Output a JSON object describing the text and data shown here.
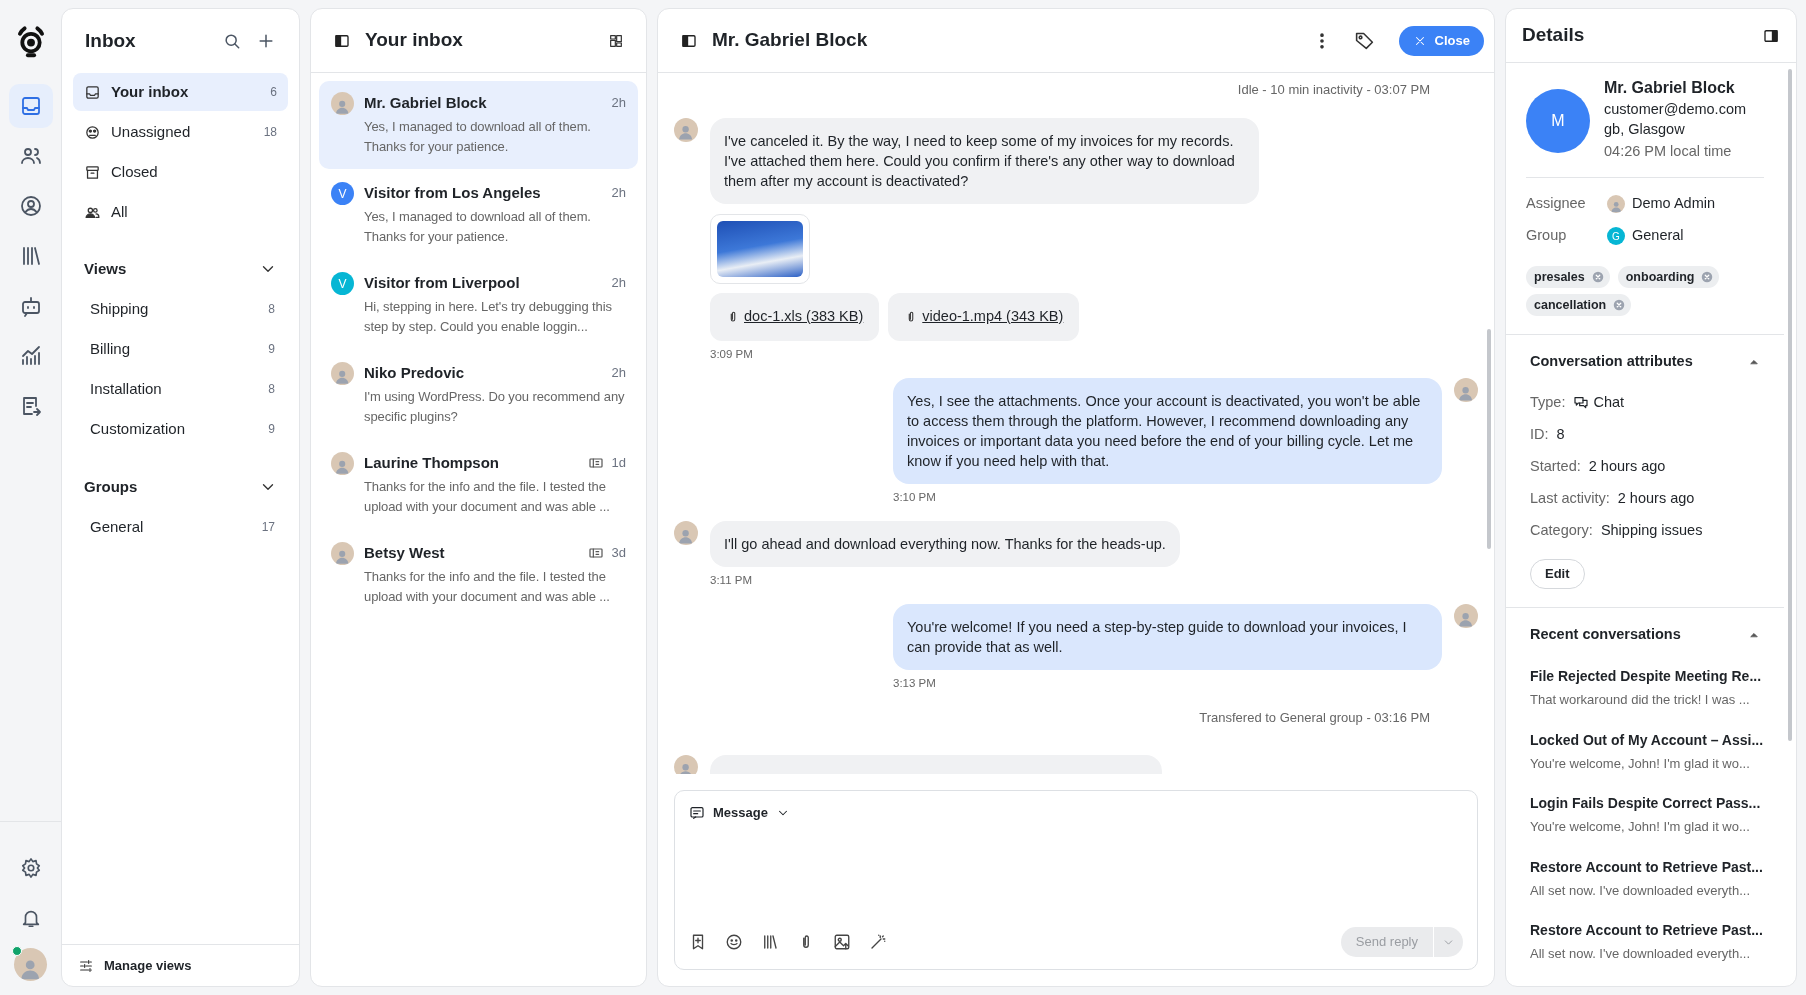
{
  "rail": {
    "items": [
      {
        "selected": true
      },
      {
        "selected": false
      },
      {
        "selected": false
      },
      {
        "selected": false
      },
      {
        "selected": false
      },
      {
        "selected": false
      },
      {
        "selected": false
      }
    ],
    "user": {
      "online": true
    }
  },
  "inbox": {
    "title": "Inbox",
    "folders": [
      {
        "label": "Your inbox",
        "count": "6",
        "selected": true
      },
      {
        "label": "Unassigned",
        "count": "18",
        "selected": false
      },
      {
        "label": "Closed",
        "selected": false
      },
      {
        "label": "All",
        "selected": false
      }
    ],
    "sections": [
      {
        "title": "Views",
        "expanded": true,
        "items": [
          {
            "label": "Shipping",
            "count": "8"
          },
          {
            "label": "Billing",
            "count": "9"
          },
          {
            "label": "Installation",
            "count": "8"
          },
          {
            "label": "Customization",
            "count": "9"
          }
        ]
      },
      {
        "title": "Groups",
        "expanded": true,
        "items": [
          {
            "label": "General",
            "count": "17"
          }
        ]
      }
    ],
    "footer": "Manage views"
  },
  "conversations": {
    "title": "Your inbox",
    "items": [
      {
        "name": "Mr. Gabriel Block",
        "time": "2h",
        "preview": "Yes, I managed to download all of them. Thanks for your patience.",
        "avatar": {
          "kind": "photo"
        },
        "ticket": false,
        "selected": true
      },
      {
        "name": "Visitor from Los Angeles",
        "time": "2h",
        "preview": "Yes, I managed to download all of them. Thanks for your patience.",
        "avatar": {
          "kind": "letter",
          "letter": "V",
          "color": "#3b82f6"
        },
        "ticket": false,
        "selected": false
      },
      {
        "name": "Visitor from Liverpool",
        "time": "2h",
        "preview": "Hi, stepping in here. Let's try debugging this step by step. Could you enable loggin...",
        "avatar": {
          "kind": "letter",
          "letter": "V",
          "color": "#06b6d4"
        },
        "ticket": false,
        "selected": false
      },
      {
        "name": "Niko Predovic",
        "time": "2h",
        "preview": "I'm using WordPress. Do you recommend any specific plugins?",
        "avatar": {
          "kind": "photo"
        },
        "ticket": false,
        "selected": false
      },
      {
        "name": "Laurine Thompson",
        "time": "1d",
        "preview": "Thanks for the info and the file. I tested the upload with your document and was able ...",
        "avatar": {
          "kind": "photo"
        },
        "ticket": true,
        "selected": false
      },
      {
        "name": "Betsy West",
        "time": "3d",
        "preview": "Thanks for the info and the file. I tested the upload with your document and was able ...",
        "avatar": {
          "kind": "photo"
        },
        "ticket": true,
        "selected": false
      }
    ]
  },
  "chat": {
    "title": "Mr. Gabriel Block",
    "close_label": "Close",
    "messages": [
      {
        "kind": "event",
        "text": "Idle - 10 min inactivity - 03:07 PM"
      },
      {
        "kind": "customer_message",
        "text": "I've canceled it. By the way, I need to keep some of my invoices for my records. I've attached them here. Could you confirm if there's any other way to download them after my account is deactivated?",
        "image": true,
        "files": [
          "doc-1.xls (383 KB)",
          "video-1.mp4 (343 KB)"
        ],
        "time": "3:09 PM"
      },
      {
        "kind": "agent_message",
        "text": "Yes, I see the attachments. Once your account is deactivated, you won't be able to access them through the platform. However, I recommend downloading any invoices or important data you need before the end of your billing cycle. Let me know if you need help with that.",
        "time": "3:10 PM"
      },
      {
        "kind": "customer_message",
        "text": "I'll go ahead and download everything now. Thanks for the heads-up.",
        "time": "3:11 PM"
      },
      {
        "kind": "agent_message",
        "text": "You're welcome! If you need a step-by-step guide to download your invoices, I can provide that as well.",
        "time": "3:13 PM"
      },
      {
        "kind": "event",
        "text": "Transfered to General group - 03:16 PM"
      },
      {
        "kind": "cut_off"
      }
    ],
    "composer": {
      "mode": "Message",
      "send_label": "Send reply",
      "send_disabled": true
    }
  },
  "details": {
    "title": "Details",
    "contact": {
      "initial": "M",
      "name": "Mr. Gabriel Block",
      "email": "customer@demo.com",
      "location": "gb, Glasgow",
      "local_time": "04:26 PM local time"
    },
    "assignee_label": "Assignee",
    "assignee": "Demo Admin",
    "group_label": "Group",
    "group_initial": "G",
    "group": "General",
    "tags": [
      "presales",
      "onboarding",
      "cancellation"
    ],
    "attributes": {
      "title": "Conversation attributes",
      "expanded": true,
      "rows": [
        {
          "label": "Type:",
          "value": "Chat",
          "kind": "chat"
        },
        {
          "label": "ID:",
          "value": "8",
          "kind": "plain"
        },
        {
          "label": "Started:",
          "value": "2 hours ago",
          "kind": "plain"
        },
        {
          "label": "Last activity:",
          "value": "2 hours ago",
          "kind": "plain"
        },
        {
          "label": "Category:",
          "value": "Shipping issues",
          "kind": "plain"
        }
      ],
      "edit_label": "Edit"
    },
    "recent": {
      "title": "Recent conversations",
      "expanded": true,
      "items": [
        {
          "title": "File Rejected Despite Meeting Re...",
          "preview": "That workaround did the trick! I was ..."
        },
        {
          "title": "Locked Out of My Account – Assi...",
          "preview": "You're welcome, John! I'm glad it wo..."
        },
        {
          "title": "Login Fails Despite Correct Pass...",
          "preview": "You're welcome, John! I'm glad it wo..."
        },
        {
          "title": "Restore Account to Retrieve Past...",
          "preview": "All set now. I've downloaded everyth..."
        },
        {
          "title": "Restore Account to Retrieve Past...",
          "preview": "All set now. I've downloaded everyth..."
        }
      ]
    }
  }
}
